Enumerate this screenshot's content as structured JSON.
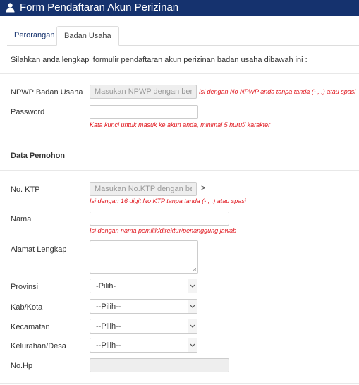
{
  "header": {
    "title": "Form Pendaftaran Akun Perizinan",
    "icon": "user-icon"
  },
  "tabs": [
    {
      "label": "Perorangan"
    },
    {
      "label": "Badan Usaha"
    }
  ],
  "intro": "Silahkan anda lengkapi formulir pendaftaran akun perizinan badan usaha dibawah ini :",
  "npwp": {
    "label": "NPWP Badan Usaha",
    "placeholder": "Masukan NPWP dengan benar",
    "hint": "Isi dengan No NPWP anda tanpa tanda (- , .) atau spasi"
  },
  "password": {
    "label": "Password",
    "hint": "Kata kunci untuk masuk ke akun anda, minimal 5 huruf/ karakter"
  },
  "section": {
    "title": "Data Pemohon"
  },
  "ktp": {
    "label": "No. KTP",
    "placeholder": "Masukan No.KTP dengan benar",
    "suffix": ">",
    "hint": "Isi dengan 16 digit No KTP tanpa tanda (- , .) atau spasi"
  },
  "nama": {
    "label": "Nama",
    "hint": "Isi dengan nama pemilik/direktur/penanggung jawab"
  },
  "alamat": {
    "label": "Alamat Lengkap"
  },
  "provinsi": {
    "label": "Provinsi",
    "selected": "-Pilih-"
  },
  "kabkota": {
    "label": "Kab/Kota",
    "selected": "--Pilih--"
  },
  "kecamatan": {
    "label": "Kecamatan",
    "selected": "--Pilih--"
  },
  "kelurahan": {
    "label": "Kelurahan/Desa",
    "selected": "--Pilih--"
  },
  "nohp": {
    "label": "No.Hp"
  },
  "colors": {
    "header_bg": "#15326e",
    "hint": "#e0161d",
    "tab_link": "#15326e"
  }
}
